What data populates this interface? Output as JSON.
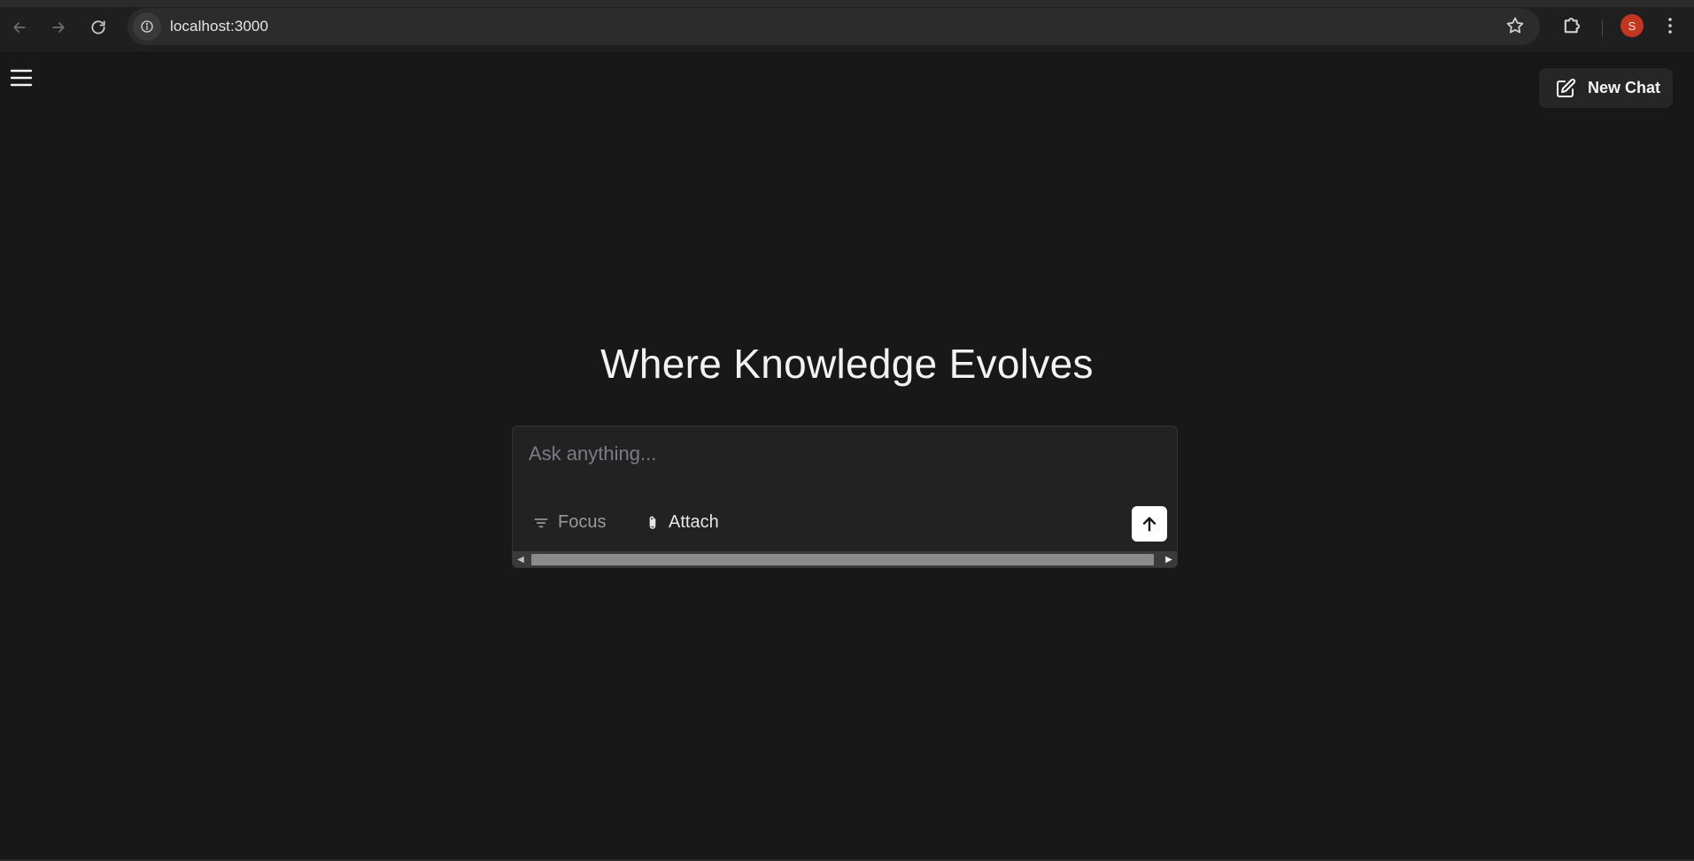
{
  "browser": {
    "url": "localhost:3000",
    "profile_initial": "S",
    "icons": {
      "back": "arrow-left-icon",
      "forward": "arrow-right-icon",
      "reload": "reload-icon",
      "site_info": "info-icon",
      "bookmark": "star-icon",
      "extensions": "puzzle-icon",
      "menu": "kebab-menu-icon"
    },
    "colors": {
      "profile_avatar": "#c3361f"
    }
  },
  "app": {
    "header": {
      "new_chat_label": "New Chat",
      "menu_icon": "hamburger-menu-icon",
      "new_chat_icon": "edit-icon"
    },
    "hero": {
      "title": "Where Knowledge Evolves"
    },
    "composer": {
      "placeholder": "Ask anything...",
      "value": "",
      "focus_label": "Focus",
      "attach_label": "Attach",
      "focus_icon": "filter-lines-icon",
      "attach_icon": "paperclip-icon",
      "send_icon": "arrow-up-icon"
    },
    "colors": {
      "background": "#181818",
      "composer_bg": "#222222",
      "send_button_bg": "#ffffff"
    }
  }
}
